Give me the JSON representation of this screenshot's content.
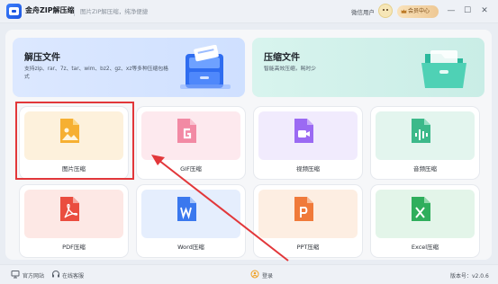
{
  "titlebar": {
    "app_name": "金舟ZIP解压缩",
    "slogan": "图片ZIP解压缩，纯净便捷",
    "user_label": "微信用户",
    "vip_label": "会员中心",
    "minimize_glyph": "—",
    "maximize_glyph": "☐",
    "close_glyph": "✕"
  },
  "banners": {
    "unzip": {
      "title": "解压文件",
      "desc": "支持zip、rar、7z、tar、wim、bz2、gz、xz等多种压缩包格式"
    },
    "zip": {
      "title": "压缩文件",
      "desc": "智能高效压缩，耗时少"
    }
  },
  "cards": [
    {
      "label": "图片压缩",
      "icon": "image-file-icon",
      "bg": "#fdf1dc",
      "accent": "#f6b032"
    },
    {
      "label": "GIF压缩",
      "icon": "gif-file-icon",
      "bg": "#fde9ee",
      "accent": "#f28aa4"
    },
    {
      "label": "视频压缩",
      "icon": "video-file-icon",
      "bg": "#f1ebfd",
      "accent": "#9b6af3"
    },
    {
      "label": "音频压缩",
      "icon": "audio-file-icon",
      "bg": "#e3f5ee",
      "accent": "#3cb98a"
    },
    {
      "label": "PDF压缩",
      "icon": "pdf-file-icon",
      "bg": "#fde8e5",
      "accent": "#ea4d3f"
    },
    {
      "label": "Word压缩",
      "icon": "word-file-icon",
      "bg": "#e5eefd",
      "accent": "#3a78ee"
    },
    {
      "label": "PPT压缩",
      "icon": "ppt-file-icon",
      "bg": "#fdeee2",
      "accent": "#f07a3a"
    },
    {
      "label": "Excel压缩",
      "icon": "excel-file-icon",
      "bg": "#e3f5e9",
      "accent": "#2fae5c"
    }
  ],
  "footer": {
    "website": "官方网站",
    "support": "在线客服",
    "login": "登录",
    "version": "版本号：v2.0.6"
  },
  "colors": {
    "highlight": "#e2373a",
    "arrow": "#e2373a"
  }
}
